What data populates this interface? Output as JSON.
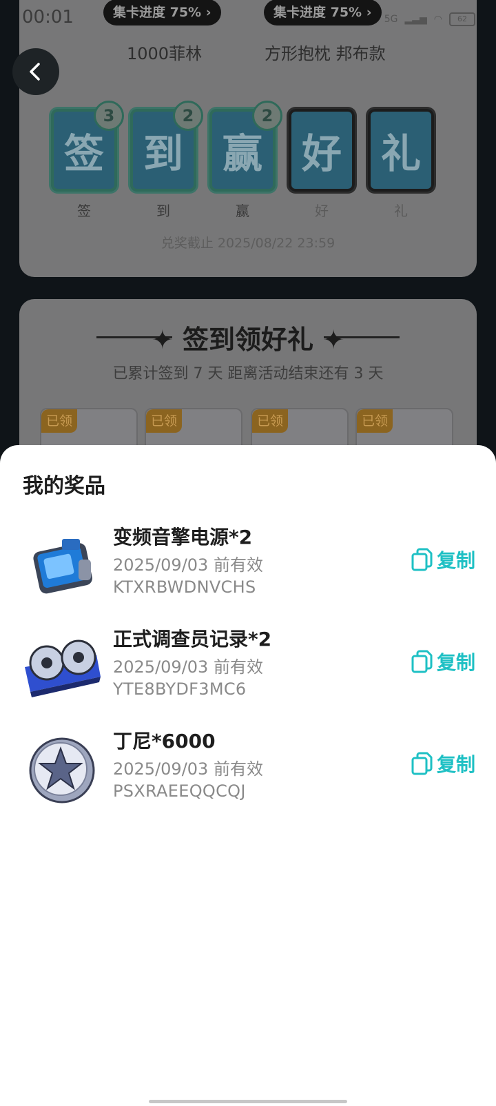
{
  "status": {
    "time": "00:01",
    "network": "5G",
    "battery": "62"
  },
  "card_top": {
    "pills": [
      "集卡进度 75%",
      "集卡进度 75%"
    ],
    "rewards": [
      "1000菲林",
      "方形抱枕 邦布款"
    ],
    "stamps": [
      {
        "char": "签",
        "label": "签",
        "count": "3",
        "collected": true
      },
      {
        "char": "到",
        "label": "到",
        "count": "2",
        "collected": true
      },
      {
        "char": "赢",
        "label": "赢",
        "count": "2",
        "collected": true
      },
      {
        "char": "好",
        "label": "好",
        "count": "",
        "collected": false
      },
      {
        "char": "礼",
        "label": "礼",
        "count": "",
        "collected": false
      }
    ],
    "deadline": "兑奖截止 2025/08/22 23:59"
  },
  "card_mid": {
    "title": "签到领好礼",
    "summary": "已累计签到 7 天  距离活动结束还有 3 天",
    "claimed_tag": "已领"
  },
  "sheet": {
    "title": "我的奖品",
    "items": [
      {
        "name": "变频音擎电源*2",
        "expiry": "2025/09/03 前有效",
        "code": "KTXRBWDNVCHS",
        "copy_label": "复制",
        "icon": "power-supply-icon"
      },
      {
        "name": "正式调查员记录*2",
        "expiry": "2025/09/03 前有效",
        "code": "YTE8BYDF3MC6",
        "copy_label": "复制",
        "icon": "tape-recorder-icon"
      },
      {
        "name": "丁尼*6000",
        "expiry": "2025/09/03 前有效",
        "code": "PSXRAEEQQCQJ",
        "copy_label": "复制",
        "icon": "coin-icon"
      }
    ]
  },
  "colors": {
    "accent": "#1ec0c4",
    "claimed_tag": "#8b6420"
  }
}
